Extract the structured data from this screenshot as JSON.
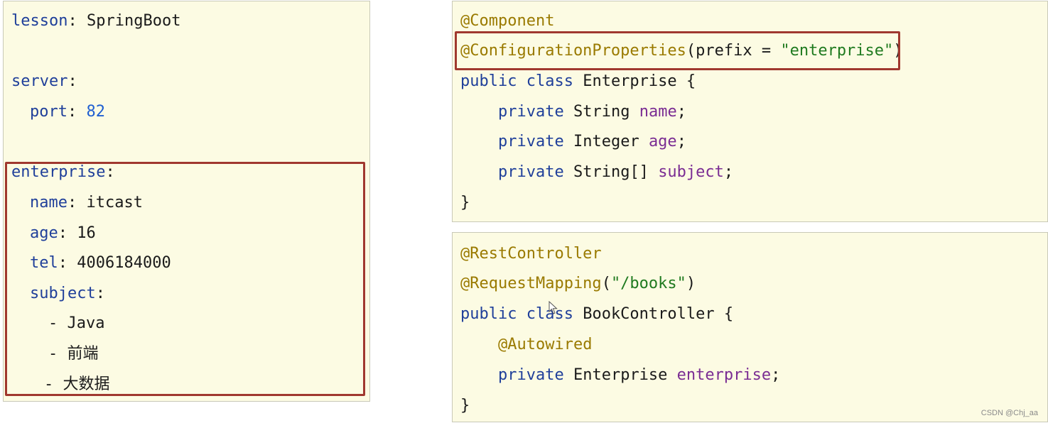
{
  "yaml": {
    "lesson_key": "lesson",
    "lesson_value": "SpringBoot",
    "server_key": "server",
    "port_key": "port",
    "port_value": "82",
    "enterprise_key": "enterprise",
    "name_key": "name",
    "name_value": "itcast",
    "age_key": "age",
    "age_value": "16",
    "tel_key": "tel",
    "tel_value": "4006184000",
    "subject_key": "subject",
    "subjects": [
      "Java",
      "前端",
      "大数据"
    ]
  },
  "enterprise_class": {
    "annotation1": "@Component",
    "annotation2": "@ConfigurationProperties",
    "annotation2_args_open": "(prefix = ",
    "prefix_value": "\"enterprise\"",
    "annotation2_args_close": ")",
    "decl_kw": "public class",
    "class_name": "Enterprise {",
    "private_kw": "private",
    "fields": [
      {
        "type": "String",
        "name": "name"
      },
      {
        "type": "Integer",
        "name": "age"
      },
      {
        "type": "String[]",
        "name": "subject"
      }
    ],
    "semicolon": ";",
    "close_brace": "}"
  },
  "controller_class": {
    "annotation1": "@RestController",
    "annotation2": "@RequestMapping",
    "mapping_open": "(",
    "mapping_value": "\"/books\"",
    "mapping_close": ")",
    "decl_kw": "public class",
    "class_name": "BookController {",
    "autowired": "@Autowired",
    "private_kw": "private",
    "field_type": "Enterprise",
    "field_name": "enterprise",
    "semicolon": ";",
    "close_brace": "}"
  },
  "watermark": "CSDN @Chj_aa"
}
